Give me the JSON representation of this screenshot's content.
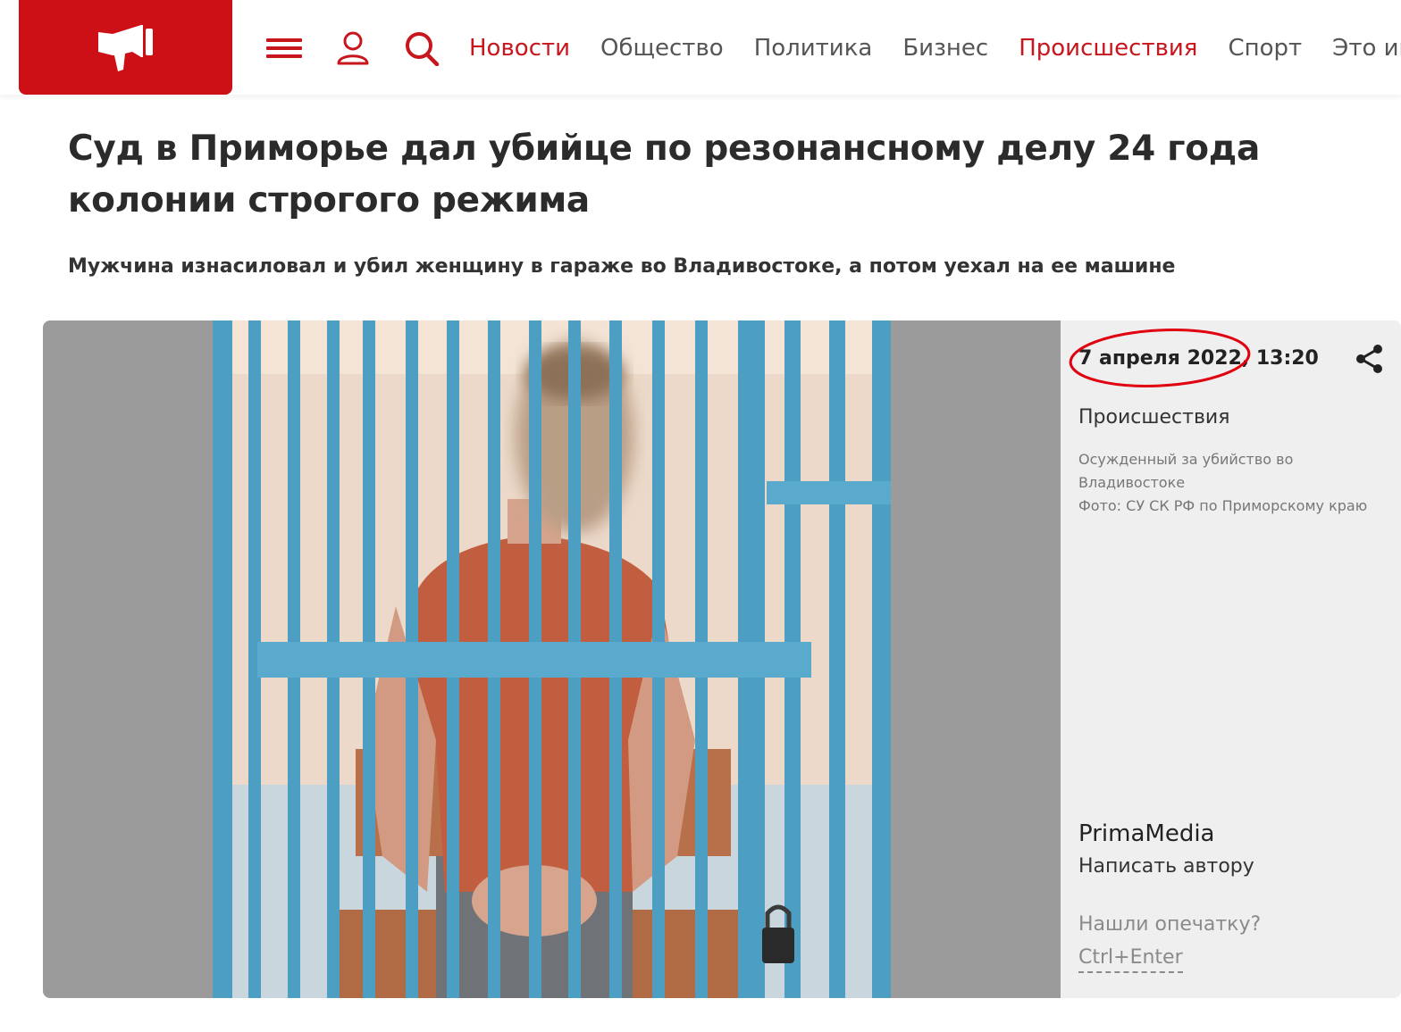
{
  "header": {
    "nav": [
      "Новости",
      "Общество",
      "Политика",
      "Бизнес",
      "Происшествия",
      "Спорт",
      "Это инт"
    ],
    "active_nav": "Происшествия",
    "highlight_nav": "Новости",
    "brand_color": "#cc1016",
    "icons": [
      "megaphone-logo-icon",
      "menu-icon",
      "user-icon",
      "search-icon"
    ]
  },
  "article": {
    "title": "Суд в Приморье дал убийце по резонансному делу 24 года колонии строгого режима",
    "lead": "Мужчина изнасиловал и убил женщину в гараже во Владивостоке, а потом уехал на ее машине"
  },
  "sidebar": {
    "date": "7 апреля 2022, 13:20",
    "rubric": "Происшествия",
    "caption_line1": "Осужденный за убийство во Владивостоке",
    "caption_line2": "Фото: СУ СК РФ по Приморскому краю",
    "author": "PrimaMedia",
    "write_author": "Написать автору",
    "typo_question": "Нашли опечатку?",
    "hotkey": "Ctrl+Enter",
    "annotation_color": "#e0000f"
  }
}
